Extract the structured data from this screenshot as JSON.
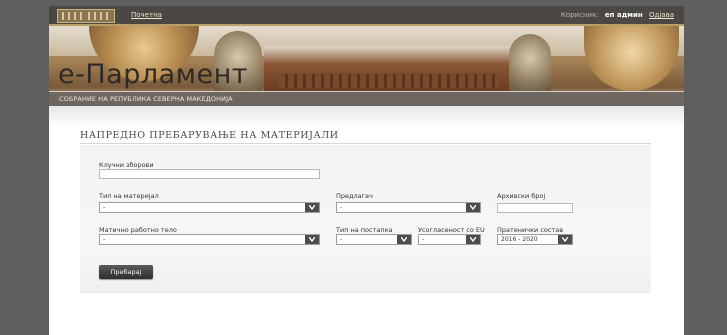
{
  "header": {
    "home_link": "Почетна",
    "user_label": "Корисник:",
    "user_name": "еп админ",
    "logout": "Одјава"
  },
  "banner": {
    "app_title": "е-Парламент",
    "subtitle": "СОБРАНИЕ НА РЕПУБЛИКА СЕВЕРНА МАКЕДОНИЈА"
  },
  "search": {
    "title": "НАПРЕДНО ПРЕБАРУВАЊЕ НА МАТЕРИЈАЛИ",
    "keywords_label": "Клучни зборови",
    "keywords_value": "",
    "material_type_label": "Тип на материјал",
    "material_type_value": "-",
    "proposer_label": "Предлагач",
    "proposer_value": "-",
    "archive_label": "Архивски број",
    "archive_value": "",
    "working_body_label": "Матично работно тело",
    "working_body_value": "-",
    "procedure_type_label": "Тип на постапка",
    "procedure_type_value": "-",
    "eu_label": "Усогласеност со EU",
    "eu_value": "-",
    "composition_label": "Пратенички состав",
    "composition_value": "2016 - 2020",
    "submit": "Пребарај"
  },
  "icons": {
    "dropdown": "chevron-down-icon",
    "logo": "parliament-building-icon"
  },
  "colors": {
    "topbar": "#4a4744",
    "subtitle_bar": "#6e6660",
    "button": "#2e2e2e",
    "select_arrow": "#4d4d4d"
  }
}
